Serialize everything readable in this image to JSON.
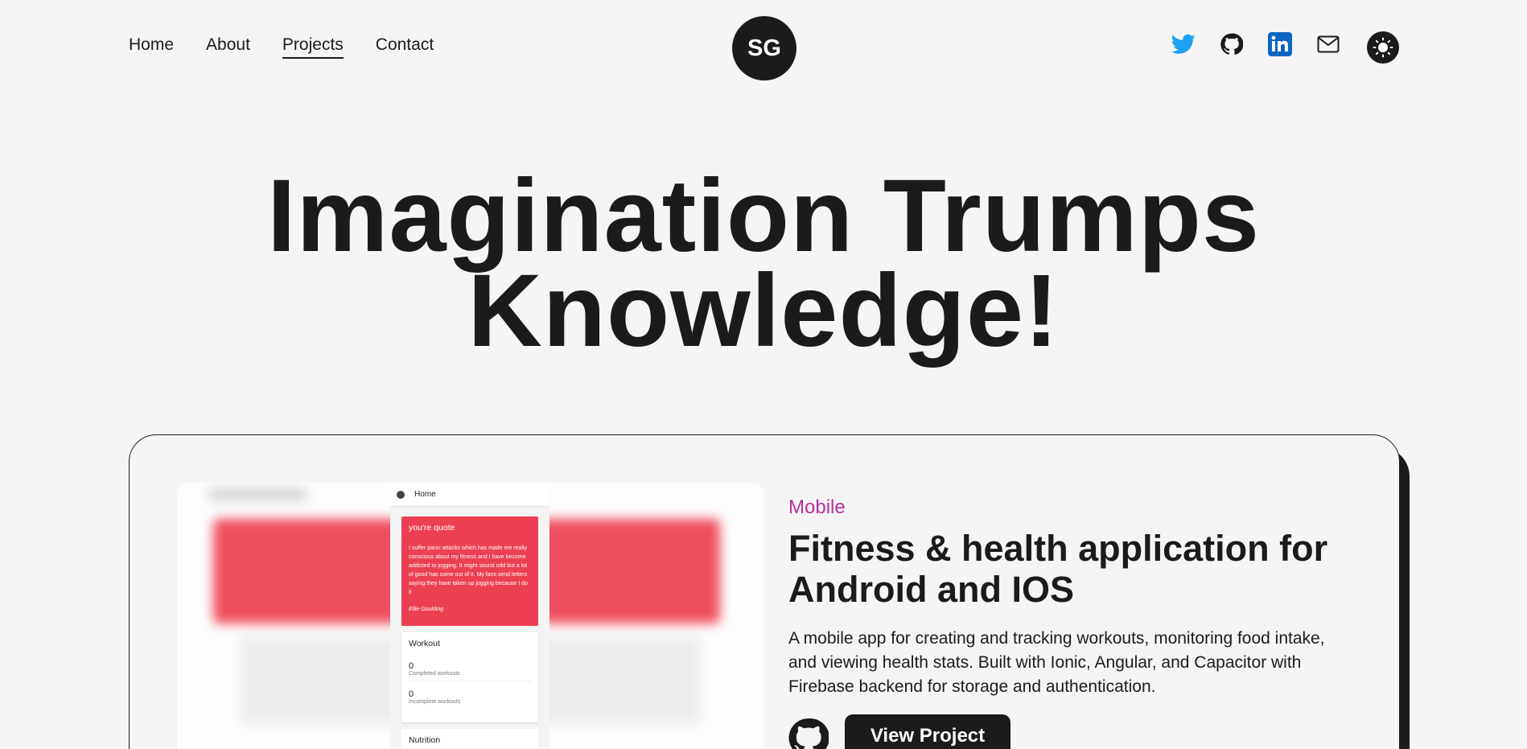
{
  "nav": {
    "items": [
      {
        "label": "Home"
      },
      {
        "label": "About"
      },
      {
        "label": "Projects"
      },
      {
        "label": "Contact"
      }
    ]
  },
  "logo": {
    "text": "SG"
  },
  "socials": [
    "twitter-icon",
    "github-icon",
    "linkedin-icon",
    "mail-icon"
  ],
  "theme_toggle": {
    "icon": "sun-icon"
  },
  "colors": {
    "text": "#1b1b1b",
    "background": "#f5f5f5",
    "accent": "#b5309b",
    "twitter": "#1da1f2",
    "linkedin": "#0a66c2",
    "quote_red": "#ec3f52"
  },
  "hero": {
    "line1": "Imagination Trumps",
    "line2": "Knowledge!"
  },
  "project": {
    "tag": "Mobile",
    "title": "Fitness & health application for Android and IOS",
    "description": "A mobile app for creating and tracking workouts, monitoring food intake, and viewing health stats. Built with Ionic, Angular, and Capacitor with Firebase backend for storage and authentication.",
    "view_button": "View Project",
    "screenshot": {
      "topbar": "Home",
      "quote_heading": "you're quote",
      "quote_body": "I suffer panic attacks which has made me really conscious about my fitness and I have become addicted to jogging. It might sound odd but a lot of good has come out of it. My fans send letters saying they have taken up jogging because I do it",
      "quote_author": "Ellie Goulding",
      "workout_heading": "Workout",
      "completed_value": "0",
      "completed_label": "Completed workouts",
      "incomplete_value": "0",
      "incomplete_label": "Incomplete workouts",
      "nutrition_heading": "Nutrition"
    }
  }
}
